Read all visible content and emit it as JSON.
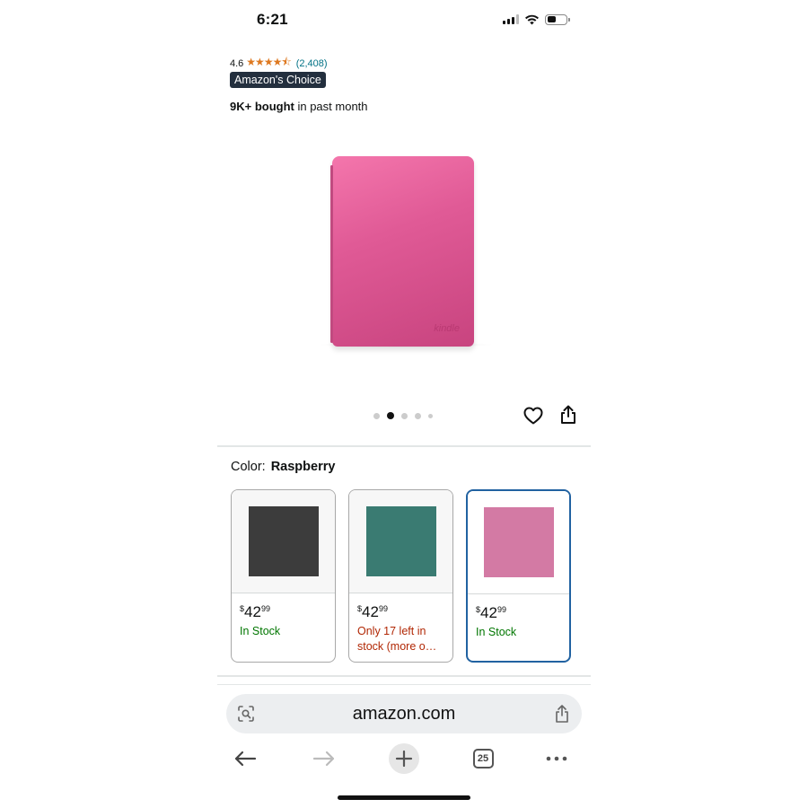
{
  "status_bar": {
    "time": "6:21",
    "battery_level": 0.45
  },
  "product": {
    "rating": "4.6",
    "stars": "★★★★⯪",
    "rating_count": "(2,408)",
    "badge": "Amazon's Choice",
    "bought_bold": "9K+ bought",
    "bought_rest": " in past month",
    "image_mark": "kindle",
    "image_color": "#e05a96"
  },
  "carousel": {
    "total_images": 5,
    "active_index": 1
  },
  "color_selector": {
    "label": "Color:",
    "selected": "Raspberry",
    "options": [
      {
        "color": "#3c3c3c",
        "price_symbol": "$",
        "price_whole": "42",
        "price_fraction": "99",
        "stock": "In Stock",
        "stock_type": "green"
      },
      {
        "color": "#3a7b72",
        "price_symbol": "$",
        "price_whole": "42",
        "price_fraction": "99",
        "stock": "Only 17 left in stock (more o…",
        "stock_type": "red"
      },
      {
        "color": "#d37aa4",
        "price_symbol": "$",
        "price_whole": "42",
        "price_fraction": "99",
        "stock": "In Stock",
        "stock_type": "green",
        "selected": true
      }
    ]
  },
  "browser": {
    "url": "amazon.com",
    "tab_count": "25"
  },
  "icons": {
    "lens": "lens-icon",
    "share": "share-icon",
    "back": "back-arrow-icon",
    "forward": "forward-arrow-icon",
    "new_tab": "plus-icon",
    "tabs": "tabs-icon",
    "more": "more-icon",
    "wishlist": "heart-icon"
  },
  "colors": {
    "link": "#007185",
    "star": "#de7921",
    "badge_bg": "#232f3e",
    "in_stock": "#007600",
    "low_stock": "#b12704",
    "selected_border": "#2162a1"
  }
}
